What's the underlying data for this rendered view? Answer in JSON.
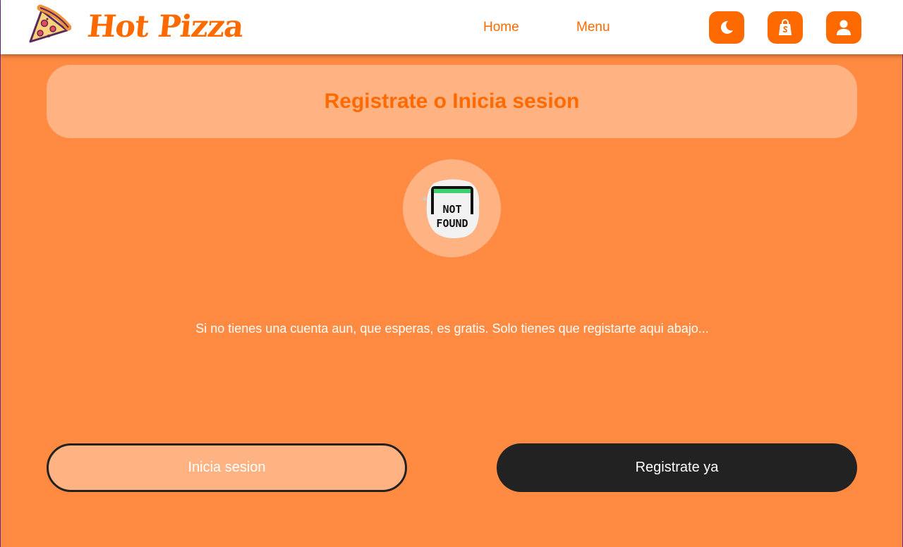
{
  "header": {
    "brand": "Hot Pizza",
    "nav": [
      {
        "label": "Home"
      },
      {
        "label": "Menu"
      }
    ],
    "icons": {
      "theme": "moon-icon",
      "cart": "shopping-bag-icon",
      "user": "user-icon",
      "logo": "pizza-slice-icon"
    }
  },
  "main": {
    "title": "Registrate o Inicia sesion",
    "avatar_image": "not-found-image",
    "avatar_text": [
      "NOT",
      "FOUND"
    ],
    "message": "Si no tienes una cuenta aun, que esperas, es gratis. Solo tienes que registarte aqui abajo...",
    "login_label": "Inicia sesion",
    "register_label": "Registrate ya"
  },
  "colors": {
    "accent": "#ff6a00",
    "background": "#ff8a42",
    "card": "#ffb383",
    "dark": "#222222"
  }
}
